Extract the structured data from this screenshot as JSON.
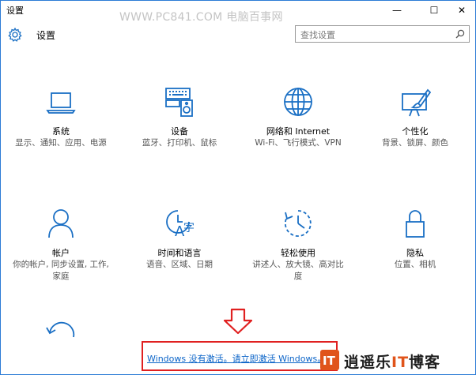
{
  "window": {
    "title": "设置",
    "watermark": "WWW.PC841.COM 电脑百事网",
    "minimize_glyph": "—",
    "maximize_glyph": "☐",
    "close_glyph": "✕"
  },
  "header": {
    "title": "设置",
    "search_placeholder": "查找设置"
  },
  "tiles": [
    {
      "name": "系统",
      "desc": "显示、通知、应用、电源",
      "icon": "laptop-icon"
    },
    {
      "name": "设备",
      "desc": "蓝牙、打印机、鼠标",
      "icon": "devices-icon"
    },
    {
      "name": "网络和 Internet",
      "desc": "Wi-Fi、飞行模式、VPN",
      "icon": "globe-icon"
    },
    {
      "name": "个性化",
      "desc": "背景、锁屏、颜色",
      "icon": "paint-icon"
    },
    {
      "name": "帐户",
      "desc": "你的帐户, 同步设置, 工作, 家庭",
      "icon": "person-icon"
    },
    {
      "name": "时间和语言",
      "desc": "语音、区域、日期",
      "icon": "time-language-icon"
    },
    {
      "name": "轻松使用",
      "desc": "讲述人、放大镜、高对比度",
      "icon": "ease-of-access-icon"
    },
    {
      "name": "隐私",
      "desc": "位置、相机",
      "icon": "lock-icon"
    }
  ],
  "activation": {
    "link_text": "Windows 没有激活。请立即激活 Windows。"
  },
  "logo": {
    "mark": "IT",
    "text_a": "逍遥乐",
    "text_it": "IT",
    "text_b": "博客"
  },
  "colors": {
    "accent": "#1a6fc4",
    "link": "#0b64c8",
    "highlight_border": "#e02020",
    "logo_accent": "#e0541b"
  }
}
